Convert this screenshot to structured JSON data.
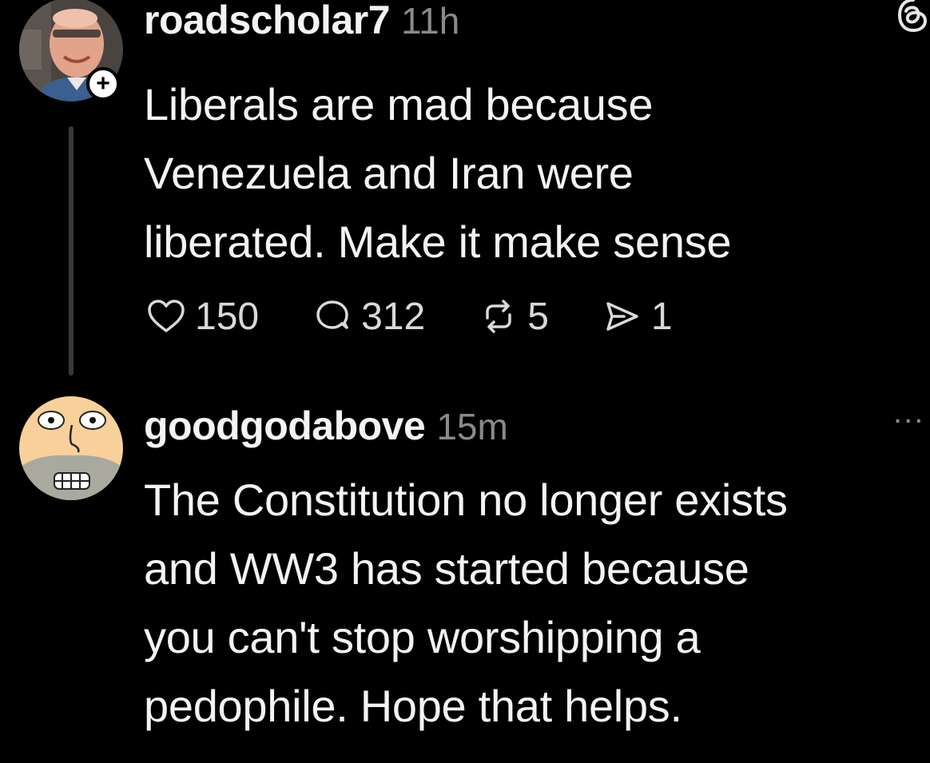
{
  "posts": [
    {
      "username": "roadscholar7",
      "time": "11h",
      "text": "Liberals are mad because\nVenezuela and Iran were\nliberated. Make it make sense",
      "follow_symbol": "+",
      "likes": "150",
      "replies": "312",
      "reposts": "5",
      "shares": "1"
    },
    {
      "username": "goodgodabove",
      "time": "15m",
      "text": "The Constitution no longer exists\nand WW3 has started because\nyou can't stop worshipping a\npedophile. Hope that helps.",
      "more_symbol": "..."
    }
  ],
  "icons": {
    "app": "threads-logo-icon",
    "like": "heart-icon",
    "reply": "comment-icon",
    "repost": "repost-icon",
    "share": "send-icon",
    "follow": "plus-icon",
    "more": "more-dots-icon"
  },
  "colors": {
    "background": "#000000",
    "text": "#f3f3f3",
    "muted": "#8a8a8a",
    "thread_line": "#3a3a3a"
  }
}
